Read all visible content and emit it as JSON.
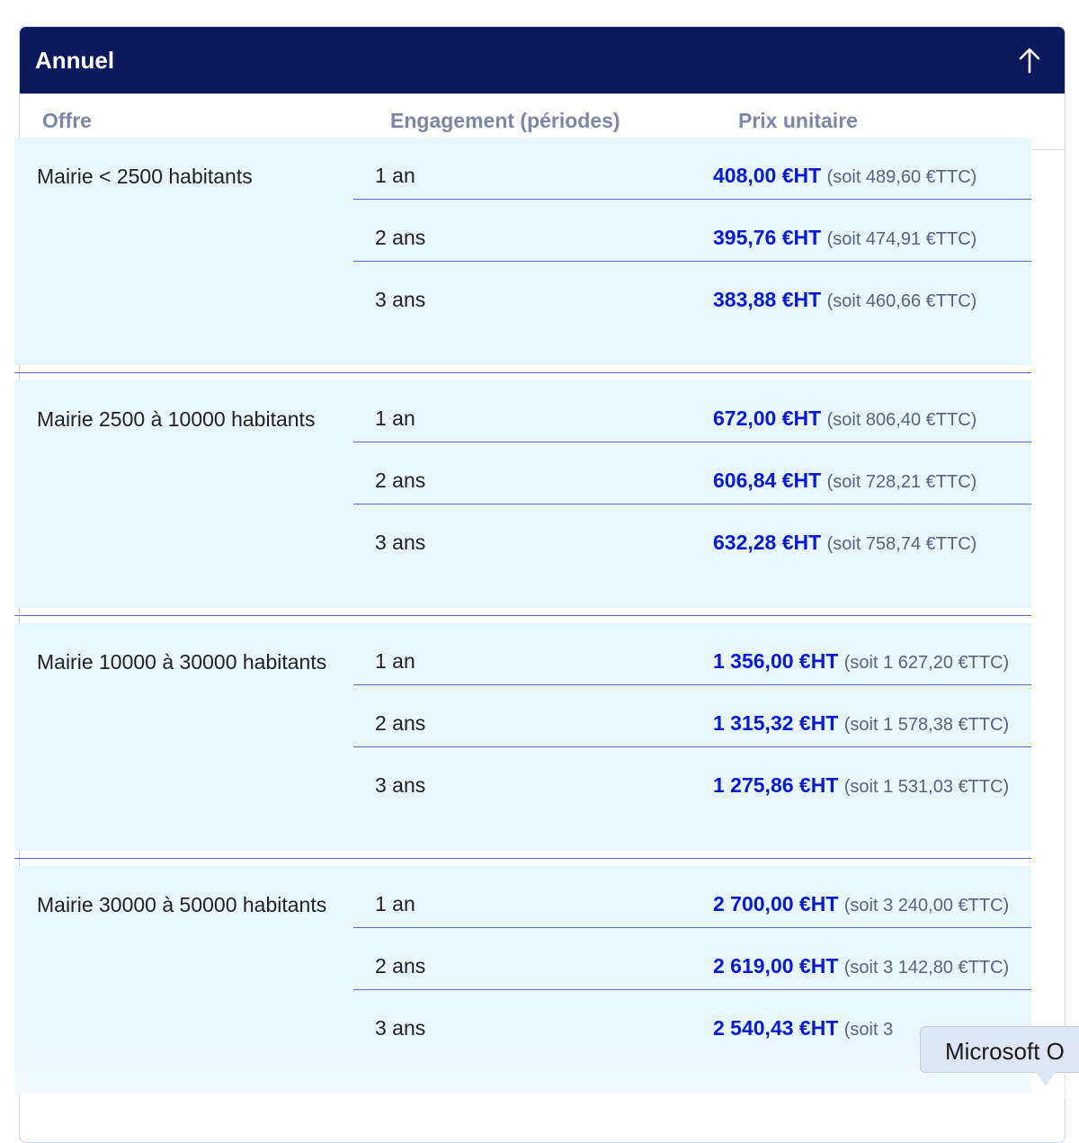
{
  "panel": {
    "title": "Annuel",
    "columns": [
      "Offre",
      "Engagement (périodes)",
      "Prix unitaire"
    ]
  },
  "groups": [
    {
      "offer": "Mairie < 2500 habitants",
      "rows": [
        {
          "duration": "1 an",
          "price_ht": "408,00 €HT",
          "price_ttc": "(soit 489,60 €TTC)"
        },
        {
          "duration": "2 ans",
          "price_ht": "395,76 €HT",
          "price_ttc": "(soit 474,91 €TTC)"
        },
        {
          "duration": "3 ans",
          "price_ht": "383,88 €HT",
          "price_ttc": "(soit 460,66 €TTC)"
        }
      ]
    },
    {
      "offer": "Mairie 2500 à 10000 habitants",
      "rows": [
        {
          "duration": "1 an",
          "price_ht": "672,00 €HT",
          "price_ttc": "(soit 806,40 €TTC)"
        },
        {
          "duration": "2 ans",
          "price_ht": "606,84 €HT",
          "price_ttc": "(soit 728,21 €TTC)"
        },
        {
          "duration": "3 ans",
          "price_ht": "632,28 €HT",
          "price_ttc": "(soit 758,74 €TTC)"
        }
      ]
    },
    {
      "offer": "Mairie 10000 à 30000 habitants",
      "rows": [
        {
          "duration": "1 an",
          "price_ht": "1 356,00 €HT",
          "price_ttc": "(soit 1 627,20 €TTC)"
        },
        {
          "duration": "2 ans",
          "price_ht": "1 315,32 €HT",
          "price_ttc": "(soit 1 578,38 €TTC)"
        },
        {
          "duration": "3 ans",
          "price_ht": "1 275,86 €HT",
          "price_ttc": "(soit 1 531,03 €TTC)"
        }
      ]
    },
    {
      "offer": "Mairie 30000 à 50000 habitants",
      "rows": [
        {
          "duration": "1 an",
          "price_ht": "2 700,00 €HT",
          "price_ttc": "(soit 3 240,00 €TTC)"
        },
        {
          "duration": "2 ans",
          "price_ht": "2 619,00 €HT",
          "price_ttc": "(soit 3 142,80 €TTC)"
        },
        {
          "duration": "3 ans",
          "price_ht": "2 540,43 €HT",
          "price_ttc": "(soit 3"
        }
      ]
    }
  ],
  "tooltip": {
    "text": "Microsoft O"
  },
  "icons": {
    "collapse": "arrow-up-icon"
  },
  "colors": {
    "header_bg": "#0b1a5c",
    "row_bg": "#e8f6fd",
    "price_ht": "#0a1ad0",
    "separator": "#5a6ac0"
  }
}
